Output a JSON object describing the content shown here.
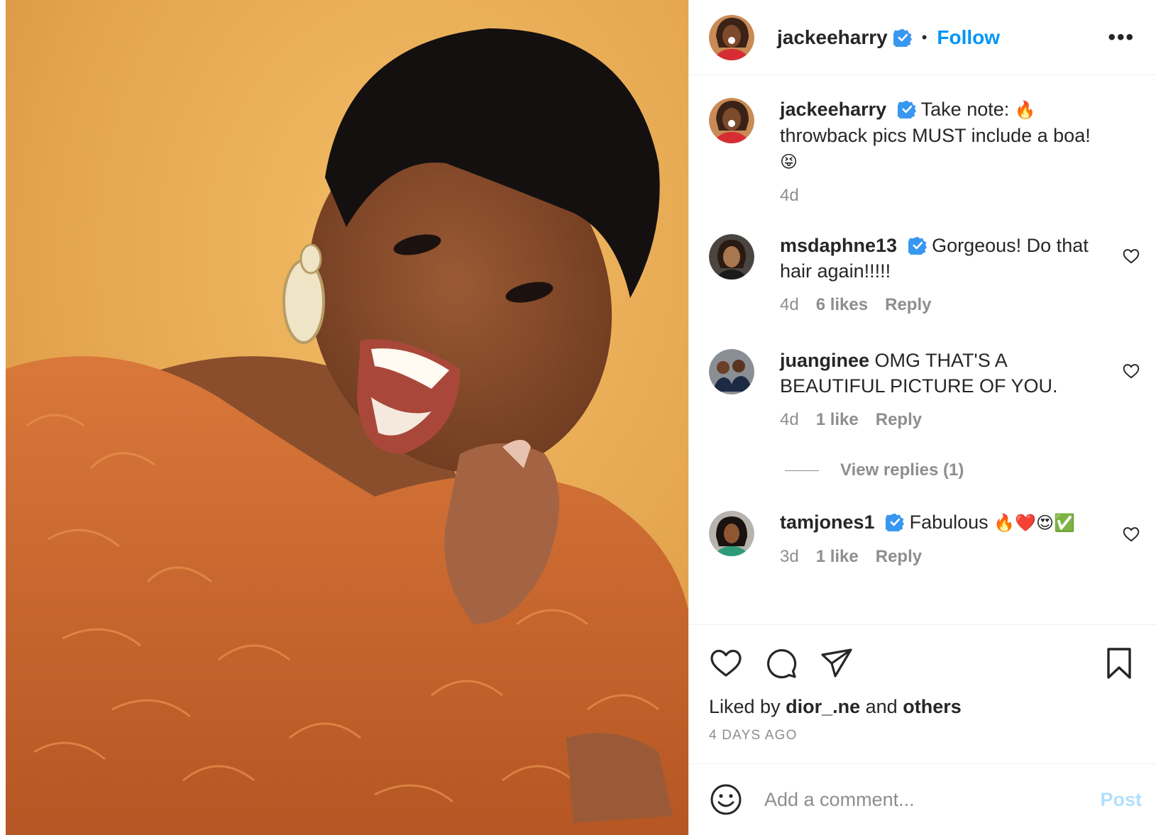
{
  "post": {
    "author": "jackeeharry",
    "follow_label": "Follow",
    "separator": "•",
    "more_label": "•••"
  },
  "comments": [
    {
      "username": "jackeeharry",
      "verified": true,
      "text": "Take note:",
      "emoji_inline": "🔥",
      "text2": "throwback pics MUST include a boa!",
      "emoji_after": "😝",
      "time": "4d"
    },
    {
      "username": "msdaphne13",
      "verified": true,
      "text": "Gorgeous! Do that hair again!!!!!",
      "time": "4d",
      "likes": "6 likes",
      "reply": "Reply"
    },
    {
      "username": "juanginee",
      "verified": false,
      "text": "OMG THAT'S A BEAUTIFUL PICTURE OF YOU.",
      "time": "4d",
      "likes": "1 like",
      "reply": "Reply"
    },
    {
      "username": "tamjones1",
      "verified": true,
      "text": "Fabulous",
      "emoji_after": "🔥❤️😍✅",
      "time": "3d",
      "likes": "1 like",
      "reply": "Reply"
    }
  ],
  "view_replies": "View replies (1)",
  "likes": {
    "prefix": "Liked by",
    "user": "dior_.ne",
    "middle": "and",
    "others": "others"
  },
  "date": "4 DAYS AGO",
  "comment_box": {
    "placeholder": "Add a comment...",
    "post_label": "Post"
  },
  "colors": {
    "accent": "#0095f6",
    "post_disabled": "#b2dffc",
    "muted": "#8e8e8e",
    "photo_background": "#e2a24c",
    "boa": "#c8642a"
  },
  "icons": [
    "verified-badge-icon",
    "more-options-icon",
    "heart-icon",
    "comment-icon",
    "share-icon",
    "bookmark-icon",
    "smile-emoji-icon"
  ]
}
